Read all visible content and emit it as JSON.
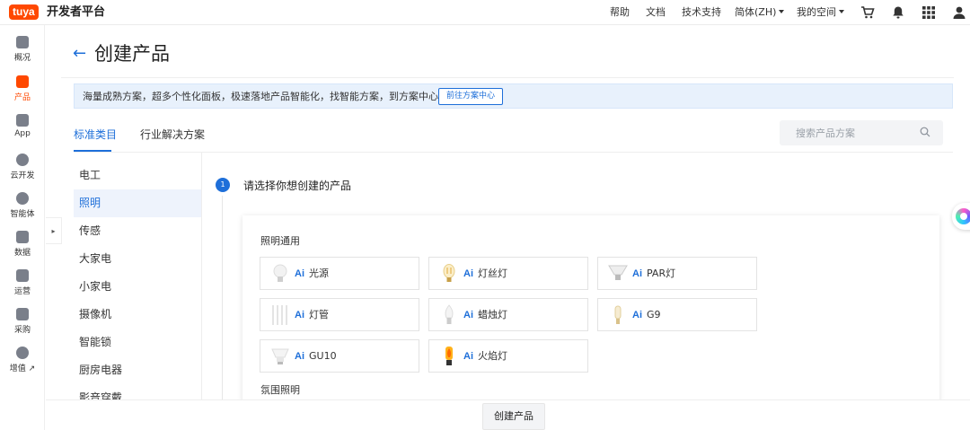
{
  "topbar": {
    "logo_text": "tuya",
    "brand": "开发者平台",
    "help": "帮助",
    "docs": "文档",
    "support": "技术支持",
    "language": "简体(ZH)",
    "space": "我的空间"
  },
  "sidebar": {
    "items": [
      {
        "label": "概况"
      },
      {
        "label": "产品"
      },
      {
        "label": "App"
      },
      {
        "label": "云开发"
      },
      {
        "label": "智能体"
      },
      {
        "label": "数据"
      },
      {
        "label": "运营"
      },
      {
        "label": "采购"
      },
      {
        "label": "增值 ↗"
      }
    ],
    "collapse_glyph": "▸"
  },
  "page": {
    "title": "创建产品",
    "banner_text": "海量成熟方案，超多个性化面板，极速落地产品智能化，找智能方案，到方案中心",
    "banner_button": "前往方案中心",
    "tabs": [
      "标准类目",
      "行业解决方案"
    ],
    "search_placeholder": "搜索产品方案"
  },
  "categories": [
    "电工",
    "照明",
    "传感",
    "大家电",
    "小家电",
    "摄像机",
    "智能锁",
    "厨房电器",
    "影音穿戴"
  ],
  "step": {
    "number": "1",
    "title": "请选择你想创建的产品"
  },
  "groups": [
    {
      "title": "照明通用",
      "products": [
        {
          "ai": "Ai",
          "label": "光源",
          "icon": "bulb-icon"
        },
        {
          "ai": "Ai",
          "label": "灯丝灯",
          "icon": "filament-bulb-icon"
        },
        {
          "ai": "Ai",
          "label": "PAR灯",
          "icon": "par-lamp-icon"
        },
        {
          "ai": "Ai",
          "label": "灯管",
          "icon": "tube-light-icon"
        },
        {
          "ai": "Ai",
          "label": "蜡烛灯",
          "icon": "candle-bulb-icon"
        },
        {
          "ai": "Ai",
          "label": "G9",
          "icon": "g9-bulb-icon"
        },
        {
          "ai": "Ai",
          "label": "GU10",
          "icon": "gu10-bulb-icon"
        },
        {
          "ai": "Ai",
          "label": "火焰灯",
          "icon": "flame-bulb-icon"
        }
      ]
    },
    {
      "title": "氛围照明",
      "products": []
    }
  ],
  "footer": {
    "create_button": "创建产品"
  },
  "colors": {
    "accent": "#1e6fd9",
    "brand": "#ff4800"
  }
}
